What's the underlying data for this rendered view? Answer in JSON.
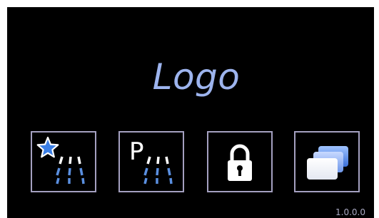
{
  "logo": {
    "text": "Logo"
  },
  "buttons": [
    {
      "name": "favorite-wash-button",
      "icon": "star-spray-icon"
    },
    {
      "name": "park-wash-button",
      "icon": "p-spray-icon",
      "letter": "P"
    },
    {
      "name": "lock-button",
      "icon": "padlock-icon"
    },
    {
      "name": "windows-button",
      "icon": "stacked-windows-icon"
    }
  ],
  "version": "1.0.0.0",
  "colors": {
    "background": "#000000",
    "logo": "#9db4ee",
    "button_border": "#a4a0c0",
    "spray_white": "#ffffff",
    "spray_blue": "#5a8fe0",
    "star": "#3b7fe6"
  }
}
